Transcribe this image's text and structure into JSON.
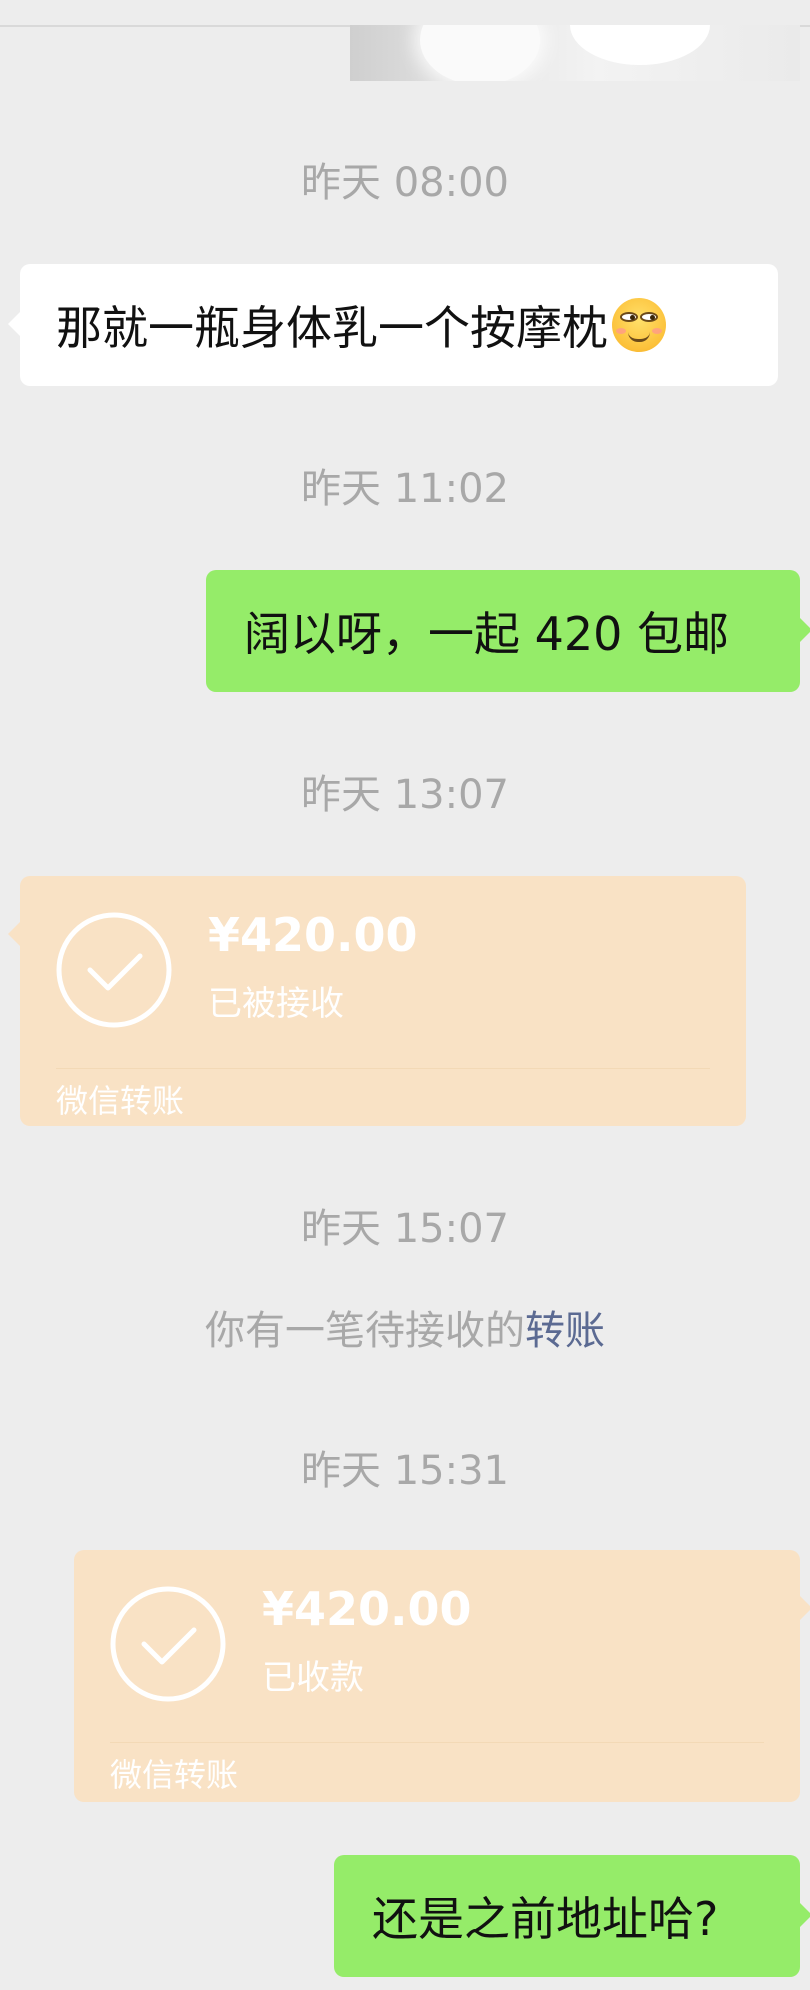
{
  "messages": {
    "ts1": "昨天 08:00",
    "msg1_text": "那就一瓶身体乳一个按摩枕",
    "msg1_emoji": "smirk-emoji",
    "ts2": "昨天 11:02",
    "msg2_text": "阔以呀，一起 420 包邮",
    "ts3": "昨天 13:07",
    "transfer1": {
      "amount": "¥420.00",
      "status": "已被接收",
      "footer": "微信转账"
    },
    "ts4": "昨天 15:07",
    "notice_text": "你有一笔待接收的",
    "notice_link": "转账",
    "ts5": "昨天 15:31",
    "transfer2": {
      "amount": "¥420.00",
      "status": "已收款",
      "footer": "微信转账"
    },
    "msg3_text": "还是之前地址哈?"
  },
  "icons": {
    "transfer_check": "check-circle-icon"
  },
  "colors": {
    "background": "#ededed",
    "bubble_self": "#95ec69",
    "bubble_other": "#ffffff",
    "transfer_card": "#f9e2c5",
    "timestamp": "#a8a8a8",
    "link": "#5b6a92"
  }
}
